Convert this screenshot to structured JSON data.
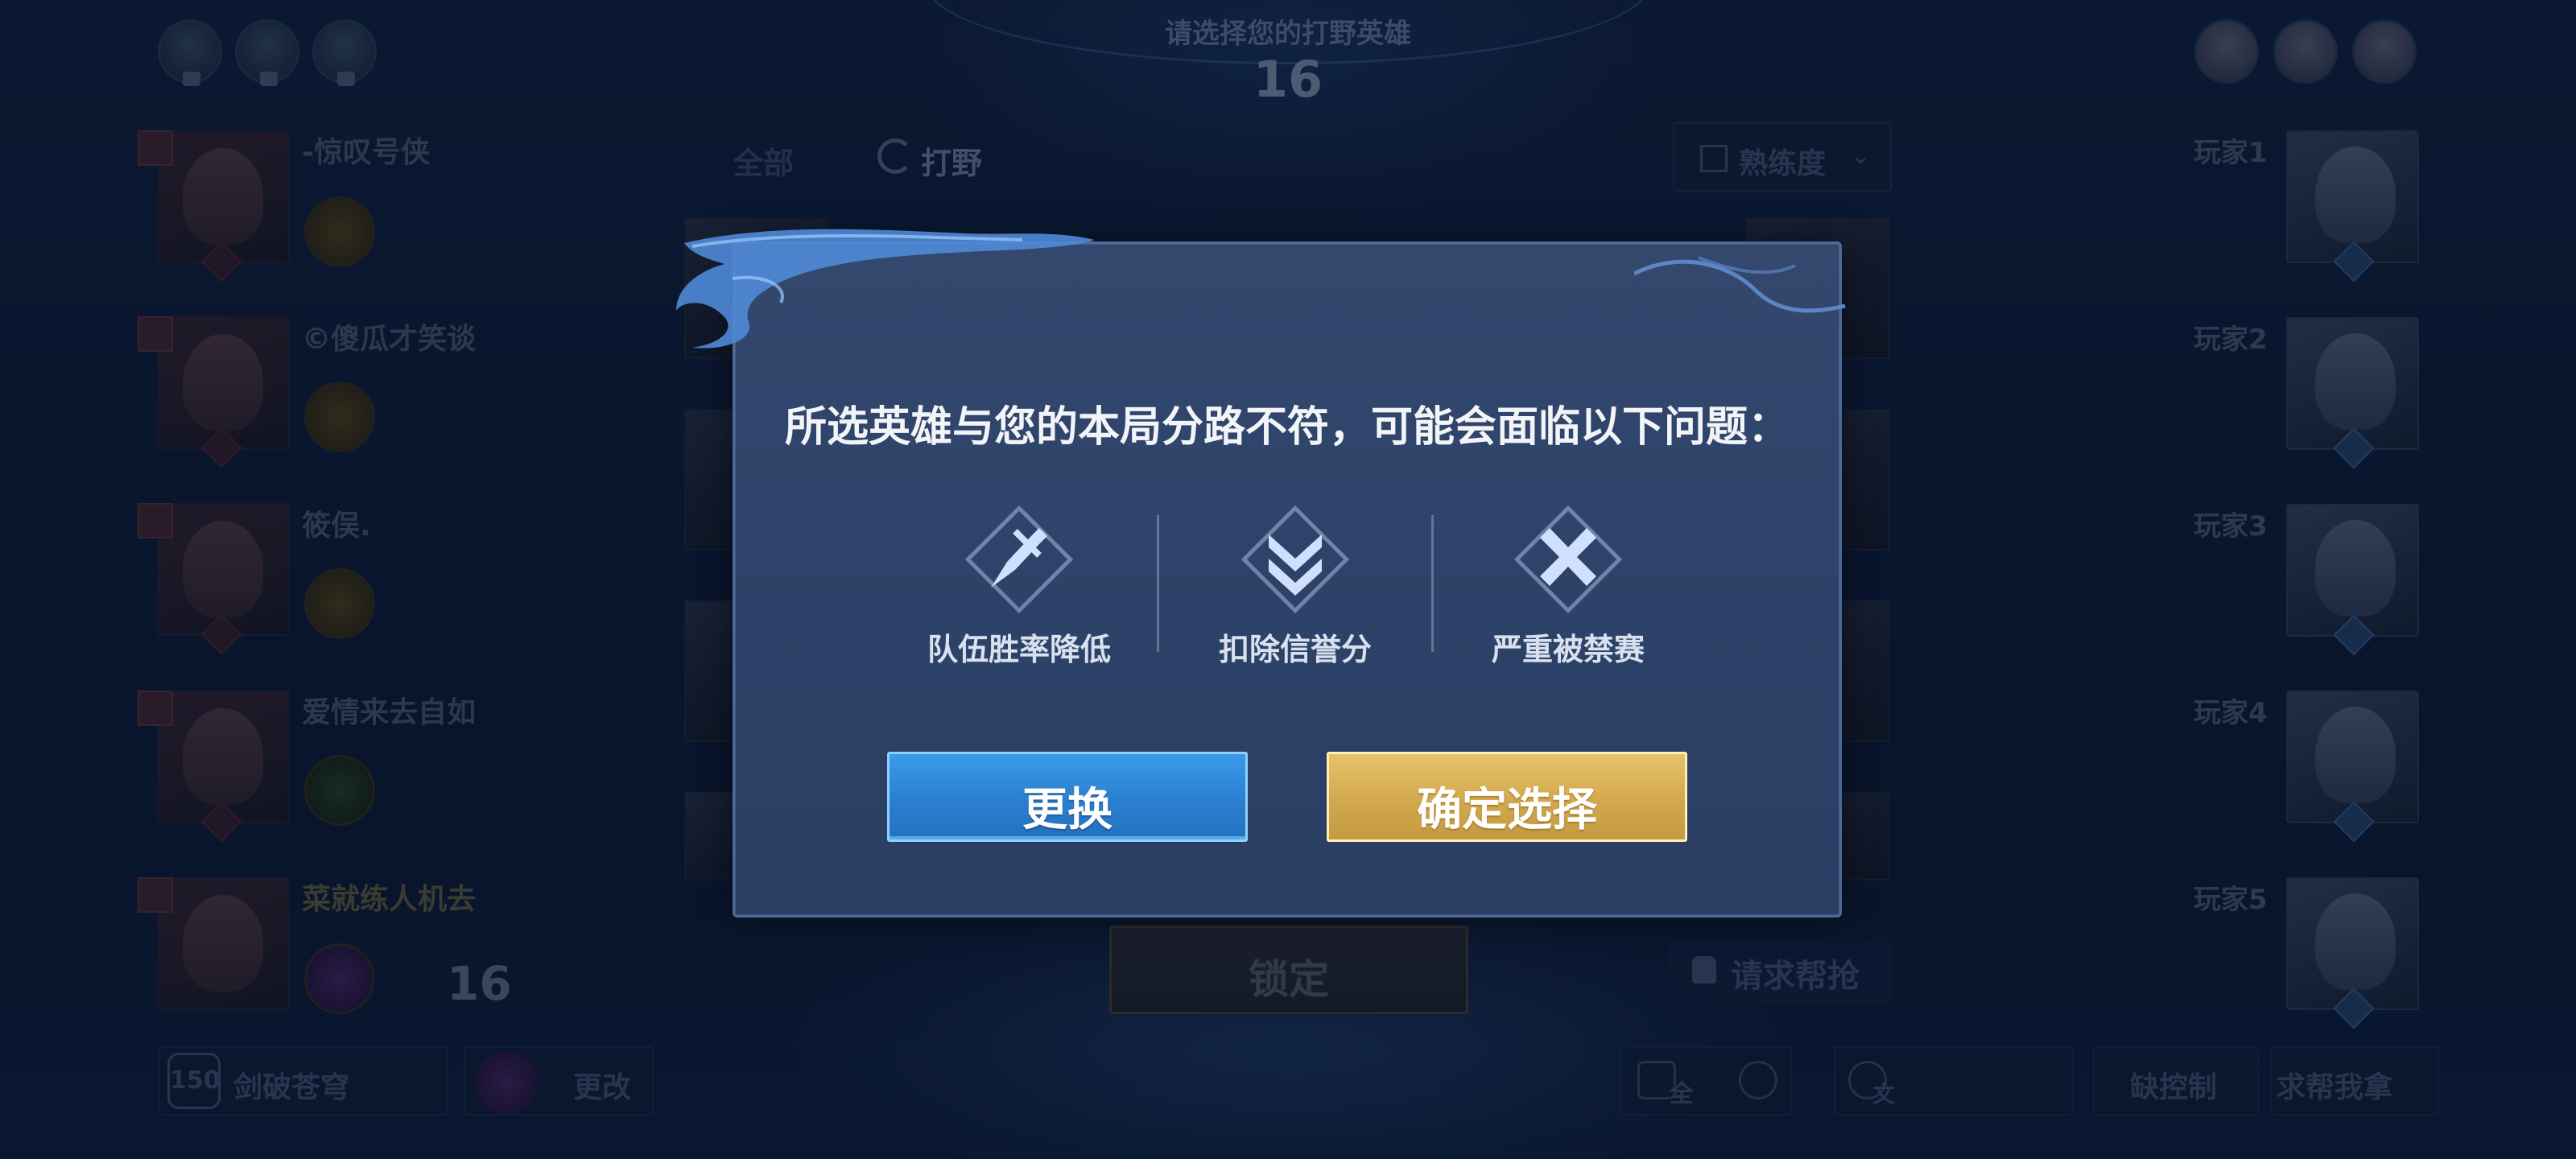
{
  "header": {
    "title": "请选择您的打野英雄",
    "countdown": "16"
  },
  "left_team": [
    {
      "name": "-惊叹号侠",
      "highlight": false
    },
    {
      "name": "©傻瓜才笑谈",
      "highlight": false
    },
    {
      "name": "筱俣.",
      "highlight": false
    },
    {
      "name": "爱情来去自如",
      "highlight": false
    },
    {
      "name": "菜就练人机去",
      "highlight": true
    }
  ],
  "left_timer": "16",
  "right_team": [
    {
      "name": "玩家1"
    },
    {
      "name": "玩家2"
    },
    {
      "name": "玩家3"
    },
    {
      "name": "玩家4"
    },
    {
      "name": "玩家5"
    }
  ],
  "tabs": {
    "all": "全部",
    "jungle": "打野"
  },
  "proficiency": {
    "label": "熟练度"
  },
  "lock_button": "锁定",
  "help_button": "请求帮抢",
  "bottom_bar": {
    "level": "150",
    "skin_name": "剑破苍穹",
    "change": "更改",
    "voice_all": "全",
    "voice_text": "文",
    "lack_control": "缺控制",
    "help_me": "求帮我拿"
  },
  "modal": {
    "message": "所选英雄与您的本局分路不符，可能会面临以下问题：",
    "warnings": [
      {
        "label": "队伍胜率降低",
        "icon": "sword-down-icon"
      },
      {
        "label": "扣除信誉分",
        "icon": "double-chevron-down-icon"
      },
      {
        "label": "严重被禁赛",
        "icon": "cross-icon"
      }
    ],
    "change_button": "更换",
    "confirm_button": "确定选择"
  },
  "colors": {
    "accent_blue": "#2b7fd0",
    "accent_gold": "#d3a94f",
    "panel": "#2d4268"
  }
}
